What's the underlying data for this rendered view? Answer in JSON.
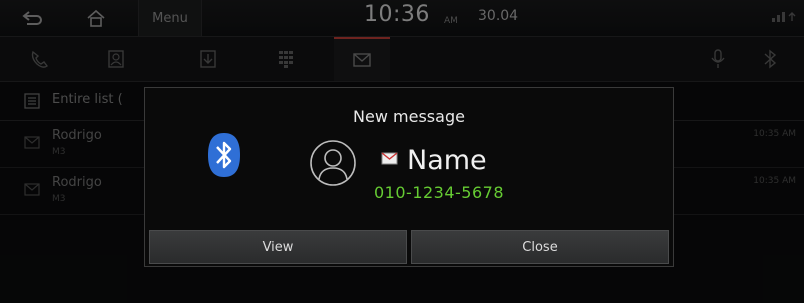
{
  "statusbar": {
    "menu_label": "Menu",
    "time": "10:36",
    "ampm": "AM",
    "date": "30.04",
    "icons": [
      "back-icon",
      "home-icon",
      "signal-icon"
    ]
  },
  "tabs": [
    {
      "icon": "call-history-icon"
    },
    {
      "icon": "contacts-icon"
    },
    {
      "icon": "download-icon"
    },
    {
      "icon": "dialpad-icon"
    },
    {
      "icon": "message-icon",
      "active": true
    },
    {
      "icon": "microphone-icon"
    },
    {
      "icon": "bluetooth-settings-icon"
    }
  ],
  "list": {
    "header": "Entire list (",
    "rows": [
      {
        "name": "Rodrigo",
        "sub": "M3",
        "time": "10:35 AM"
      },
      {
        "name": "Rodrigo",
        "sub": "M3",
        "time": "10:35 AM"
      }
    ]
  },
  "popup": {
    "title": "New message",
    "name": "Name",
    "phone": "010-1234-5678",
    "view_label": "View",
    "close_label": "Close"
  },
  "colors": {
    "accent_green": "#66cc33",
    "bluetooth_blue": "#2f6fd6",
    "active_tab": "#c9413a"
  }
}
